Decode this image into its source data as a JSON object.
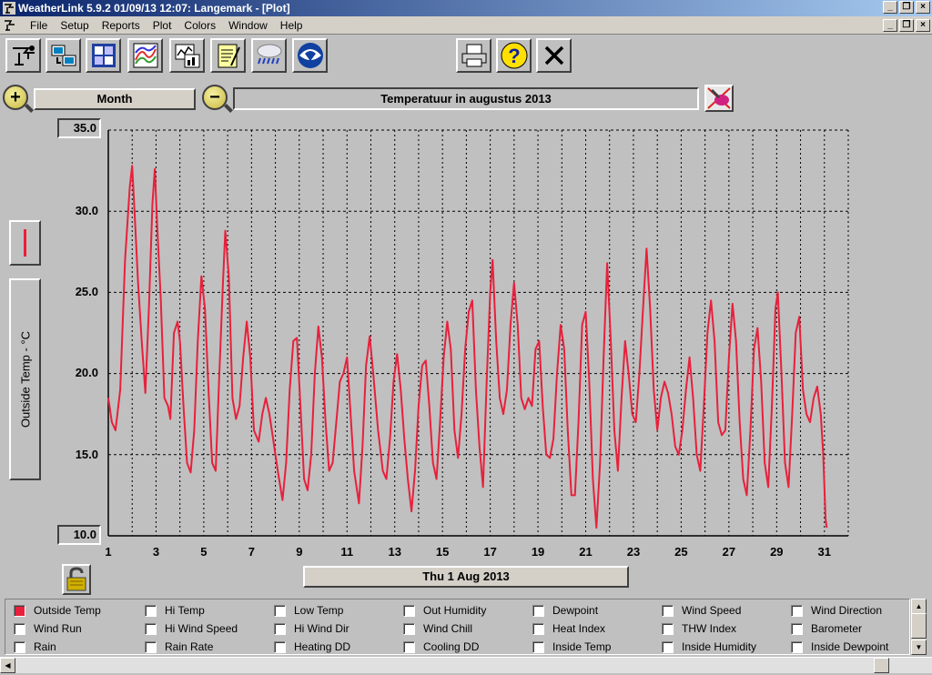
{
  "window": {
    "title": "WeatherLink 5.9.2  01/09/13  12:07: Langemark - [Plot]"
  },
  "menu": {
    "items": [
      "File",
      "Setup",
      "Reports",
      "Plot",
      "Colors",
      "Window",
      "Help"
    ]
  },
  "toolbar": {
    "icons": [
      "station-icon",
      "download-icon",
      "bulletin-icon",
      "summary-icon",
      "plot-icon",
      "notes-icon",
      "weather-icon",
      "noaa-icon",
      "print-icon",
      "help-icon",
      "close-icon"
    ]
  },
  "controls": {
    "period": "Month",
    "plot_title": "Temperatuur in augustus 2013",
    "date_label": "Thu 1 Aug 2013"
  },
  "chart_data": {
    "type": "line",
    "title": "Temperatuur in augustus 2013",
    "ylabel": "Outside Temp - °C",
    "ylim": [
      10,
      35
    ],
    "y_ticks": [
      "35.0",
      "30.0",
      "25.0",
      "20.0",
      "15.0",
      "10.0"
    ],
    "x_ticks": [
      "1",
      "3",
      "5",
      "7",
      "9",
      "11",
      "13",
      "15",
      "17",
      "19",
      "21",
      "23",
      "25",
      "27",
      "29",
      "31"
    ],
    "xlim": [
      1,
      32
    ],
    "grid": true,
    "series": [
      {
        "name": "Outside Temp",
        "color": "#e8203c",
        "points": [
          [
            1.0,
            18.5
          ],
          [
            1.15,
            17.0
          ],
          [
            1.3,
            16.5
          ],
          [
            1.5,
            19.0
          ],
          [
            1.7,
            27.0
          ],
          [
            1.9,
            31.5
          ],
          [
            2.0,
            32.8
          ],
          [
            2.1,
            30.0
          ],
          [
            2.25,
            25.5
          ],
          [
            2.4,
            22.0
          ],
          [
            2.55,
            18.8
          ],
          [
            2.7,
            24.0
          ],
          [
            2.85,
            30.5
          ],
          [
            2.95,
            32.6
          ],
          [
            3.05,
            29.0
          ],
          [
            3.2,
            24.5
          ],
          [
            3.35,
            18.5
          ],
          [
            3.5,
            18.0
          ],
          [
            3.6,
            17.2
          ],
          [
            3.75,
            22.5
          ],
          [
            3.9,
            23.2
          ],
          [
            4.0,
            22.0
          ],
          [
            4.15,
            18.0
          ],
          [
            4.3,
            14.5
          ],
          [
            4.45,
            13.9
          ],
          [
            4.6,
            16.5
          ],
          [
            4.75,
            22.0
          ],
          [
            4.9,
            26.0
          ],
          [
            5.05,
            24.0
          ],
          [
            5.2,
            19.0
          ],
          [
            5.35,
            14.5
          ],
          [
            5.5,
            14.0
          ],
          [
            5.65,
            20.0
          ],
          [
            5.8,
            25.5
          ],
          [
            5.9,
            28.8
          ],
          [
            6.05,
            26.0
          ],
          [
            6.2,
            18.5
          ],
          [
            6.35,
            17.2
          ],
          [
            6.5,
            18.0
          ],
          [
            6.65,
            21.0
          ],
          [
            6.8,
            23.2
          ],
          [
            6.95,
            21.0
          ],
          [
            7.1,
            16.5
          ],
          [
            7.3,
            15.8
          ],
          [
            7.45,
            17.5
          ],
          [
            7.6,
            18.5
          ],
          [
            7.75,
            17.5
          ],
          [
            7.9,
            16.0
          ],
          [
            8.1,
            14.0
          ],
          [
            8.3,
            12.2
          ],
          [
            8.45,
            14.5
          ],
          [
            8.6,
            19.0
          ],
          [
            8.75,
            22.0
          ],
          [
            8.9,
            22.2
          ],
          [
            9.05,
            18.0
          ],
          [
            9.2,
            13.5
          ],
          [
            9.35,
            12.8
          ],
          [
            9.5,
            15.0
          ],
          [
            9.65,
            20.0
          ],
          [
            9.8,
            22.9
          ],
          [
            9.95,
            21.0
          ],
          [
            10.1,
            17.0
          ],
          [
            10.25,
            14.0
          ],
          [
            10.4,
            14.5
          ],
          [
            10.55,
            17.0
          ],
          [
            10.7,
            19.5
          ],
          [
            10.85,
            20.0
          ],
          [
            11.0,
            21.0
          ],
          [
            11.15,
            17.5
          ],
          [
            11.3,
            14.0
          ],
          [
            11.5,
            12.0
          ],
          [
            11.65,
            15.5
          ],
          [
            11.8,
            20.5
          ],
          [
            11.95,
            22.3
          ],
          [
            12.1,
            20.0
          ],
          [
            12.3,
            16.5
          ],
          [
            12.5,
            14.0
          ],
          [
            12.65,
            13.5
          ],
          [
            12.8,
            16.0
          ],
          [
            12.95,
            19.5
          ],
          [
            13.1,
            21.2
          ],
          [
            13.25,
            19.0
          ],
          [
            13.4,
            16.0
          ],
          [
            13.55,
            13.5
          ],
          [
            13.7,
            11.5
          ],
          [
            13.85,
            14.0
          ],
          [
            14.0,
            18.0
          ],
          [
            14.15,
            20.5
          ],
          [
            14.3,
            20.8
          ],
          [
            14.45,
            18.0
          ],
          [
            14.6,
            14.5
          ],
          [
            14.75,
            13.5
          ],
          [
            14.9,
            17.0
          ],
          [
            15.05,
            21.0
          ],
          [
            15.2,
            23.2
          ],
          [
            15.35,
            21.5
          ],
          [
            15.5,
            16.5
          ],
          [
            15.65,
            14.8
          ],
          [
            15.8,
            17.5
          ],
          [
            15.95,
            21.5
          ],
          [
            16.1,
            23.8
          ],
          [
            16.25,
            24.5
          ],
          [
            16.4,
            19.0
          ],
          [
            16.55,
            15.5
          ],
          [
            16.7,
            13.0
          ],
          [
            16.85,
            19.5
          ],
          [
            17.0,
            25.0
          ],
          [
            17.1,
            27.0
          ],
          [
            17.25,
            22.0
          ],
          [
            17.4,
            18.5
          ],
          [
            17.55,
            17.5
          ],
          [
            17.7,
            19.0
          ],
          [
            17.85,
            23.0
          ],
          [
            18.0,
            25.6
          ],
          [
            18.15,
            23.0
          ],
          [
            18.3,
            18.5
          ],
          [
            18.45,
            17.8
          ],
          [
            18.6,
            18.5
          ],
          [
            18.75,
            18.0
          ],
          [
            18.9,
            21.5
          ],
          [
            19.05,
            22.0
          ],
          [
            19.2,
            18.0
          ],
          [
            19.35,
            15.0
          ],
          [
            19.5,
            14.8
          ],
          [
            19.65,
            16.0
          ],
          [
            19.8,
            20.0
          ],
          [
            19.95,
            23.0
          ],
          [
            20.1,
            21.5
          ],
          [
            20.25,
            16.5
          ],
          [
            20.4,
            12.5
          ],
          [
            20.55,
            12.5
          ],
          [
            20.7,
            17.0
          ],
          [
            20.85,
            23.0
          ],
          [
            21.0,
            23.8
          ],
          [
            21.15,
            19.5
          ],
          [
            21.3,
            13.5
          ],
          [
            21.45,
            10.5
          ],
          [
            21.6,
            14.5
          ],
          [
            21.75,
            21.0
          ],
          [
            21.9,
            26.8
          ],
          [
            22.05,
            22.0
          ],
          [
            22.2,
            16.5
          ],
          [
            22.35,
            14.0
          ],
          [
            22.5,
            18.5
          ],
          [
            22.65,
            22.0
          ],
          [
            22.8,
            20.0
          ],
          [
            22.95,
            17.5
          ],
          [
            23.1,
            17.0
          ],
          [
            23.25,
            20.0
          ],
          [
            23.4,
            24.0
          ],
          [
            23.55,
            27.7
          ],
          [
            23.7,
            24.0
          ],
          [
            23.85,
            19.0
          ],
          [
            24.0,
            16.5
          ],
          [
            24.15,
            18.5
          ],
          [
            24.3,
            19.5
          ],
          [
            24.45,
            18.8
          ],
          [
            24.6,
            17.5
          ],
          [
            24.75,
            15.5
          ],
          [
            24.9,
            15.0
          ],
          [
            25.05,
            16.5
          ],
          [
            25.2,
            19.0
          ],
          [
            25.35,
            21.0
          ],
          [
            25.5,
            18.5
          ],
          [
            25.65,
            15.0
          ],
          [
            25.8,
            14.0
          ],
          [
            25.95,
            18.0
          ],
          [
            26.1,
            22.5
          ],
          [
            26.25,
            24.5
          ],
          [
            26.4,
            22.0
          ],
          [
            26.55,
            17.0
          ],
          [
            26.7,
            16.2
          ],
          [
            26.85,
            16.5
          ],
          [
            27.0,
            21.0
          ],
          [
            27.15,
            24.3
          ],
          [
            27.3,
            22.0
          ],
          [
            27.45,
            17.0
          ],
          [
            27.6,
            13.5
          ],
          [
            27.75,
            12.5
          ],
          [
            27.9,
            16.5
          ],
          [
            28.05,
            21.5
          ],
          [
            28.2,
            22.8
          ],
          [
            28.35,
            19.5
          ],
          [
            28.5,
            14.5
          ],
          [
            28.65,
            13.0
          ],
          [
            28.8,
            18.0
          ],
          [
            28.95,
            24.0
          ],
          [
            29.05,
            25.0
          ],
          [
            29.2,
            20.0
          ],
          [
            29.35,
            14.5
          ],
          [
            29.5,
            13.0
          ],
          [
            29.65,
            17.5
          ],
          [
            29.8,
            22.5
          ],
          [
            29.95,
            23.5
          ],
          [
            30.1,
            19.0
          ],
          [
            30.25,
            17.5
          ],
          [
            30.4,
            17.0
          ],
          [
            30.55,
            18.5
          ],
          [
            30.7,
            19.2
          ],
          [
            30.85,
            17.5
          ],
          [
            30.95,
            15.0
          ],
          [
            31.05,
            11.0
          ],
          [
            31.1,
            10.5
          ]
        ]
      }
    ]
  },
  "legend": {
    "items": [
      [
        "Outside Temp",
        "Hi Temp",
        "Low Temp",
        "Out Humidity",
        "Dewpoint",
        "Wind Speed",
        "Wind Direction"
      ],
      [
        "Wind Run",
        "Hi Wind Speed",
        "Hi Wind Dir",
        "Wind Chill",
        "Heat Index",
        "THW Index",
        "Barometer"
      ],
      [
        "Rain",
        "Rain Rate",
        "Heating DD",
        "Cooling DD",
        "Inside Temp",
        "Inside Humidity",
        "Inside Dewpoint"
      ]
    ],
    "checked": [
      "Outside Temp"
    ],
    "accent_color": "#e8203c"
  }
}
